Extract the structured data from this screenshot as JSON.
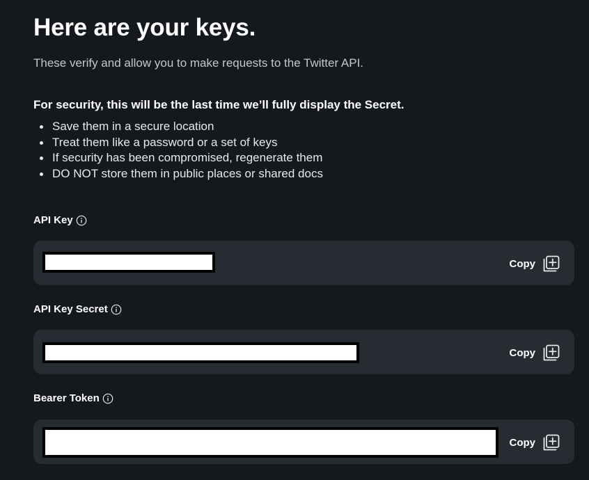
{
  "header": {
    "title": "Here are your keys.",
    "subtitle": "These verify and allow you to make requests to the Twitter API."
  },
  "security": {
    "heading": "For security, this will be the last time we’ll fully display the Secret.",
    "tips": [
      "Save them in a secure location",
      "Treat them like a password or a set of keys",
      "If security has been compromised, regenerate them",
      "DO NOT store them in public places or shared docs"
    ]
  },
  "fields": [
    {
      "label": "API Key",
      "copy_label": "Copy"
    },
    {
      "label": "API Key Secret",
      "copy_label": "Copy"
    },
    {
      "label": "Bearer Token",
      "copy_label": "Copy"
    }
  ],
  "icons": {
    "info": "info-circle-icon",
    "copy": "copy-add-icon"
  },
  "colors": {
    "background": "#15191e",
    "field_background": "#272c32",
    "text": "#e7e9ea"
  }
}
